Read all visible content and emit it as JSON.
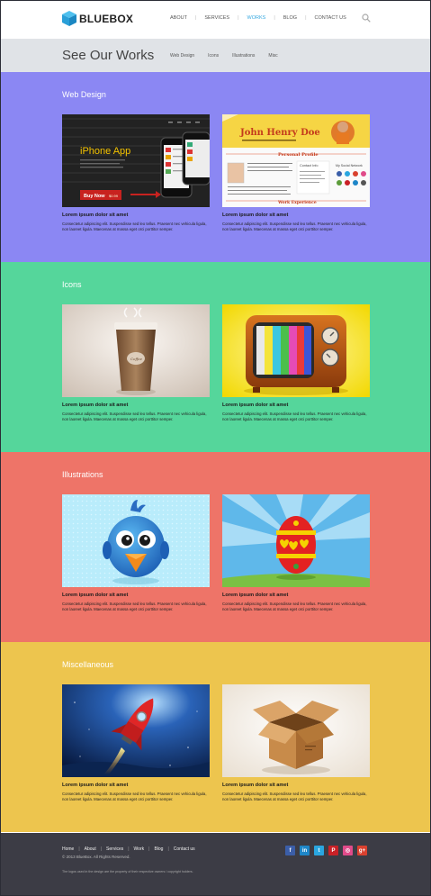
{
  "brand": {
    "name": "BLUEBOX"
  },
  "nav": {
    "items": [
      {
        "label": "ABOUT"
      },
      {
        "label": "SERVICES"
      },
      {
        "label": "WORKS",
        "active": true
      },
      {
        "label": "BLOG"
      },
      {
        "label": "CONTACT US"
      }
    ]
  },
  "page": {
    "title": "See Our Works",
    "filters": [
      "Web Design",
      "Icons",
      "Illustrations",
      "Misc"
    ]
  },
  "sections": [
    {
      "title": "Web Design",
      "color": "#8b87f3",
      "cards": [
        {
          "title": "Lorem ipsum dolor sit amet",
          "desc": "Consectetur adipiscing elit. Suspendisse sed leo tellus. Praesent nec vehicula ligula, non laoreet ligula. Maecenas at massa eget orci porttitor semper.",
          "thumb": {
            "heading": "iPhone App",
            "button": "Buy Now",
            "price": "$0.99"
          }
        },
        {
          "title": "Lorem ipsum dolor sit amet",
          "desc": "Consectetur adipiscing elit. Suspendisse sed leo tellus. Praesent nec vehicula ligula, non laoreet ligula. Maecenas at massa eget orci porttitor semper.",
          "thumb": {
            "name": "John Henry Doe",
            "profile": "Personal Profile",
            "contact": "Contact Info",
            "network": "My Social Network",
            "experience": "Work Experience"
          }
        }
      ]
    },
    {
      "title": "Icons",
      "color": "#55d69b",
      "cards": [
        {
          "title": "Lorem ipsum dolor sit amet",
          "desc": "Consectetur adipiscing elit. Suspendisse sed leo tellus. Praesent nec vehicula ligula, non laoreet ligula. Maecenas at massa eget orci porttitor semper.",
          "thumb": {
            "cup_text": "Coffee"
          }
        },
        {
          "title": "Lorem ipsum dolor sit amet",
          "desc": "Consectetur adipiscing elit. Suspendisse sed leo tellus. Praesent nec vehicula ligula, non laoreet ligula. Maecenas at massa eget orci porttitor semper."
        }
      ]
    },
    {
      "title": "Illustrations",
      "color": "#ee7468",
      "cards": [
        {
          "title": "Lorem ipsum dolor sit amet",
          "desc": "Consectetur adipiscing elit. Suspendisse sed leo tellus. Praesent nec vehicula ligula, non laoreet ligula. Maecenas at massa eget orci porttitor semper."
        },
        {
          "title": "Lorem ipsum dolor sit amet",
          "desc": "Consectetur adipiscing elit. Suspendisse sed leo tellus. Praesent nec vehicula ligula, non laoreet ligula. Maecenas at massa eget orci porttitor semper."
        }
      ]
    },
    {
      "title": "Miscellaneous",
      "color": "#edc54e",
      "cards": [
        {
          "title": "Lorem ipsum dolor sit amet",
          "desc": "Consectetur adipiscing elit. Suspendisse sed leo tellus. Praesent nec vehicula ligula, non laoreet ligula. Maecenas at massa eget orci porttitor semper."
        },
        {
          "title": "Lorem ipsum dolor sit amet",
          "desc": "Consectetur adipiscing elit. Suspendisse sed leo tellus. Praesent nec vehicula ligula, non laoreet ligula. Maecenas at massa eget orci porttitor semper."
        }
      ]
    }
  ],
  "footer": {
    "nav": [
      "Home",
      "About",
      "Services",
      "Work",
      "Blog",
      "Contact us"
    ],
    "copyright": "© 2013 BlueBox. All Rights Reserved.",
    "note": "The logos used in the design are the property of their respective owners / copyright holders.",
    "social": [
      {
        "icon": "facebook-icon",
        "glyph": "f",
        "color": "#3b5ea8"
      },
      {
        "icon": "linkedin-icon",
        "glyph": "in",
        "color": "#1e86c8"
      },
      {
        "icon": "twitter-icon",
        "glyph": "t",
        "color": "#2aa6e0"
      },
      {
        "icon": "pinterest-icon",
        "glyph": "P",
        "color": "#c92127"
      },
      {
        "icon": "dribbble-icon",
        "glyph": "◎",
        "color": "#e04b8a"
      },
      {
        "icon": "googleplus-icon",
        "glyph": "g+",
        "color": "#d9412f"
      }
    ]
  },
  "colors": {
    "accent": "#37a9e0",
    "footer_bg": "#3c3c45",
    "titlebar_bg": "#e0e3e7"
  }
}
